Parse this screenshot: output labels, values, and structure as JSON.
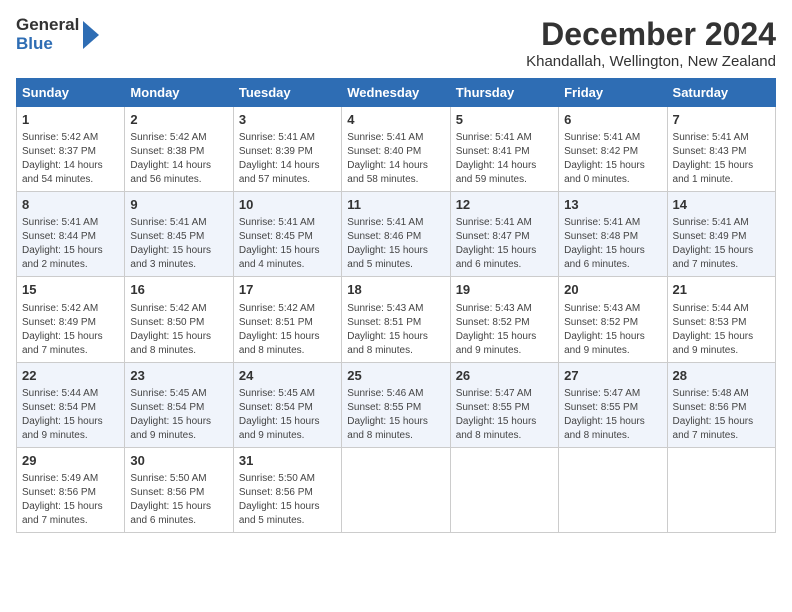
{
  "logo": {
    "general": "General",
    "blue": "Blue"
  },
  "title": "December 2024",
  "subtitle": "Khandallah, Wellington, New Zealand",
  "headers": [
    "Sunday",
    "Monday",
    "Tuesday",
    "Wednesday",
    "Thursday",
    "Friday",
    "Saturday"
  ],
  "weeks": [
    [
      {
        "day": "1",
        "detail": "Sunrise: 5:42 AM\nSunset: 8:37 PM\nDaylight: 14 hours\nand 54 minutes."
      },
      {
        "day": "2",
        "detail": "Sunrise: 5:42 AM\nSunset: 8:38 PM\nDaylight: 14 hours\nand 56 minutes."
      },
      {
        "day": "3",
        "detail": "Sunrise: 5:41 AM\nSunset: 8:39 PM\nDaylight: 14 hours\nand 57 minutes."
      },
      {
        "day": "4",
        "detail": "Sunrise: 5:41 AM\nSunset: 8:40 PM\nDaylight: 14 hours\nand 58 minutes."
      },
      {
        "day": "5",
        "detail": "Sunrise: 5:41 AM\nSunset: 8:41 PM\nDaylight: 14 hours\nand 59 minutes."
      },
      {
        "day": "6",
        "detail": "Sunrise: 5:41 AM\nSunset: 8:42 PM\nDaylight: 15 hours\nand 0 minutes."
      },
      {
        "day": "7",
        "detail": "Sunrise: 5:41 AM\nSunset: 8:43 PM\nDaylight: 15 hours\nand 1 minute."
      }
    ],
    [
      {
        "day": "8",
        "detail": "Sunrise: 5:41 AM\nSunset: 8:44 PM\nDaylight: 15 hours\nand 2 minutes."
      },
      {
        "day": "9",
        "detail": "Sunrise: 5:41 AM\nSunset: 8:45 PM\nDaylight: 15 hours\nand 3 minutes."
      },
      {
        "day": "10",
        "detail": "Sunrise: 5:41 AM\nSunset: 8:45 PM\nDaylight: 15 hours\nand 4 minutes."
      },
      {
        "day": "11",
        "detail": "Sunrise: 5:41 AM\nSunset: 8:46 PM\nDaylight: 15 hours\nand 5 minutes."
      },
      {
        "day": "12",
        "detail": "Sunrise: 5:41 AM\nSunset: 8:47 PM\nDaylight: 15 hours\nand 6 minutes."
      },
      {
        "day": "13",
        "detail": "Sunrise: 5:41 AM\nSunset: 8:48 PM\nDaylight: 15 hours\nand 6 minutes."
      },
      {
        "day": "14",
        "detail": "Sunrise: 5:41 AM\nSunset: 8:49 PM\nDaylight: 15 hours\nand 7 minutes."
      }
    ],
    [
      {
        "day": "15",
        "detail": "Sunrise: 5:42 AM\nSunset: 8:49 PM\nDaylight: 15 hours\nand 7 minutes."
      },
      {
        "day": "16",
        "detail": "Sunrise: 5:42 AM\nSunset: 8:50 PM\nDaylight: 15 hours\nand 8 minutes."
      },
      {
        "day": "17",
        "detail": "Sunrise: 5:42 AM\nSunset: 8:51 PM\nDaylight: 15 hours\nand 8 minutes."
      },
      {
        "day": "18",
        "detail": "Sunrise: 5:43 AM\nSunset: 8:51 PM\nDaylight: 15 hours\nand 8 minutes."
      },
      {
        "day": "19",
        "detail": "Sunrise: 5:43 AM\nSunset: 8:52 PM\nDaylight: 15 hours\nand 9 minutes."
      },
      {
        "day": "20",
        "detail": "Sunrise: 5:43 AM\nSunset: 8:52 PM\nDaylight: 15 hours\nand 9 minutes."
      },
      {
        "day": "21",
        "detail": "Sunrise: 5:44 AM\nSunset: 8:53 PM\nDaylight: 15 hours\nand 9 minutes."
      }
    ],
    [
      {
        "day": "22",
        "detail": "Sunrise: 5:44 AM\nSunset: 8:54 PM\nDaylight: 15 hours\nand 9 minutes."
      },
      {
        "day": "23",
        "detail": "Sunrise: 5:45 AM\nSunset: 8:54 PM\nDaylight: 15 hours\nand 9 minutes."
      },
      {
        "day": "24",
        "detail": "Sunrise: 5:45 AM\nSunset: 8:54 PM\nDaylight: 15 hours\nand 9 minutes."
      },
      {
        "day": "25",
        "detail": "Sunrise: 5:46 AM\nSunset: 8:55 PM\nDaylight: 15 hours\nand 8 minutes."
      },
      {
        "day": "26",
        "detail": "Sunrise: 5:47 AM\nSunset: 8:55 PM\nDaylight: 15 hours\nand 8 minutes."
      },
      {
        "day": "27",
        "detail": "Sunrise: 5:47 AM\nSunset: 8:55 PM\nDaylight: 15 hours\nand 8 minutes."
      },
      {
        "day": "28",
        "detail": "Sunrise: 5:48 AM\nSunset: 8:56 PM\nDaylight: 15 hours\nand 7 minutes."
      }
    ],
    [
      {
        "day": "29",
        "detail": "Sunrise: 5:49 AM\nSunset: 8:56 PM\nDaylight: 15 hours\nand 7 minutes."
      },
      {
        "day": "30",
        "detail": "Sunrise: 5:50 AM\nSunset: 8:56 PM\nDaylight: 15 hours\nand 6 minutes."
      },
      {
        "day": "31",
        "detail": "Sunrise: 5:50 AM\nSunset: 8:56 PM\nDaylight: 15 hours\nand 5 minutes."
      },
      {
        "day": "",
        "detail": ""
      },
      {
        "day": "",
        "detail": ""
      },
      {
        "day": "",
        "detail": ""
      },
      {
        "day": "",
        "detail": ""
      }
    ]
  ]
}
